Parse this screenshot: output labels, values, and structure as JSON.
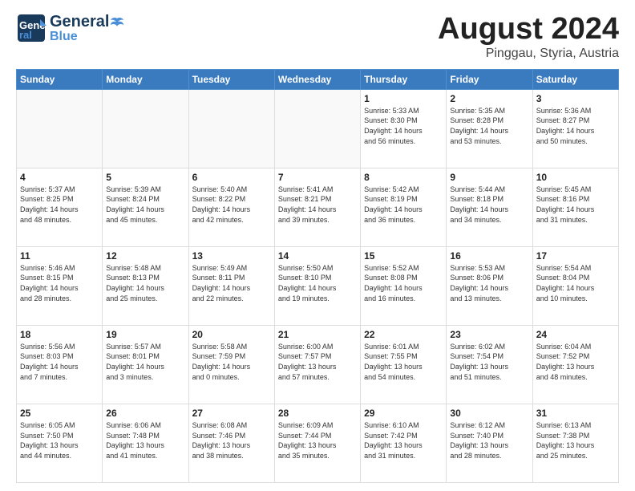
{
  "header": {
    "logo": {
      "line1": "General",
      "line2": "Blue",
      "tagline": ""
    },
    "title": "August 2024",
    "subtitle": "Pinggau, Styria, Austria"
  },
  "days_of_week": [
    "Sunday",
    "Monday",
    "Tuesday",
    "Wednesday",
    "Thursday",
    "Friday",
    "Saturday"
  ],
  "weeks": [
    [
      {
        "day": "",
        "info": ""
      },
      {
        "day": "",
        "info": ""
      },
      {
        "day": "",
        "info": ""
      },
      {
        "day": "",
        "info": ""
      },
      {
        "day": "1",
        "info": "Sunrise: 5:33 AM\nSunset: 8:30 PM\nDaylight: 14 hours\nand 56 minutes."
      },
      {
        "day": "2",
        "info": "Sunrise: 5:35 AM\nSunset: 8:28 PM\nDaylight: 14 hours\nand 53 minutes."
      },
      {
        "day": "3",
        "info": "Sunrise: 5:36 AM\nSunset: 8:27 PM\nDaylight: 14 hours\nand 50 minutes."
      }
    ],
    [
      {
        "day": "4",
        "info": "Sunrise: 5:37 AM\nSunset: 8:25 PM\nDaylight: 14 hours\nand 48 minutes."
      },
      {
        "day": "5",
        "info": "Sunrise: 5:39 AM\nSunset: 8:24 PM\nDaylight: 14 hours\nand 45 minutes."
      },
      {
        "day": "6",
        "info": "Sunrise: 5:40 AM\nSunset: 8:22 PM\nDaylight: 14 hours\nand 42 minutes."
      },
      {
        "day": "7",
        "info": "Sunrise: 5:41 AM\nSunset: 8:21 PM\nDaylight: 14 hours\nand 39 minutes."
      },
      {
        "day": "8",
        "info": "Sunrise: 5:42 AM\nSunset: 8:19 PM\nDaylight: 14 hours\nand 36 minutes."
      },
      {
        "day": "9",
        "info": "Sunrise: 5:44 AM\nSunset: 8:18 PM\nDaylight: 14 hours\nand 34 minutes."
      },
      {
        "day": "10",
        "info": "Sunrise: 5:45 AM\nSunset: 8:16 PM\nDaylight: 14 hours\nand 31 minutes."
      }
    ],
    [
      {
        "day": "11",
        "info": "Sunrise: 5:46 AM\nSunset: 8:15 PM\nDaylight: 14 hours\nand 28 minutes."
      },
      {
        "day": "12",
        "info": "Sunrise: 5:48 AM\nSunset: 8:13 PM\nDaylight: 14 hours\nand 25 minutes."
      },
      {
        "day": "13",
        "info": "Sunrise: 5:49 AM\nSunset: 8:11 PM\nDaylight: 14 hours\nand 22 minutes."
      },
      {
        "day": "14",
        "info": "Sunrise: 5:50 AM\nSunset: 8:10 PM\nDaylight: 14 hours\nand 19 minutes."
      },
      {
        "day": "15",
        "info": "Sunrise: 5:52 AM\nSunset: 8:08 PM\nDaylight: 14 hours\nand 16 minutes."
      },
      {
        "day": "16",
        "info": "Sunrise: 5:53 AM\nSunset: 8:06 PM\nDaylight: 14 hours\nand 13 minutes."
      },
      {
        "day": "17",
        "info": "Sunrise: 5:54 AM\nSunset: 8:04 PM\nDaylight: 14 hours\nand 10 minutes."
      }
    ],
    [
      {
        "day": "18",
        "info": "Sunrise: 5:56 AM\nSunset: 8:03 PM\nDaylight: 14 hours\nand 7 minutes."
      },
      {
        "day": "19",
        "info": "Sunrise: 5:57 AM\nSunset: 8:01 PM\nDaylight: 14 hours\nand 3 minutes."
      },
      {
        "day": "20",
        "info": "Sunrise: 5:58 AM\nSunset: 7:59 PM\nDaylight: 14 hours\nand 0 minutes."
      },
      {
        "day": "21",
        "info": "Sunrise: 6:00 AM\nSunset: 7:57 PM\nDaylight: 13 hours\nand 57 minutes."
      },
      {
        "day": "22",
        "info": "Sunrise: 6:01 AM\nSunset: 7:55 PM\nDaylight: 13 hours\nand 54 minutes."
      },
      {
        "day": "23",
        "info": "Sunrise: 6:02 AM\nSunset: 7:54 PM\nDaylight: 13 hours\nand 51 minutes."
      },
      {
        "day": "24",
        "info": "Sunrise: 6:04 AM\nSunset: 7:52 PM\nDaylight: 13 hours\nand 48 minutes."
      }
    ],
    [
      {
        "day": "25",
        "info": "Sunrise: 6:05 AM\nSunset: 7:50 PM\nDaylight: 13 hours\nand 44 minutes."
      },
      {
        "day": "26",
        "info": "Sunrise: 6:06 AM\nSunset: 7:48 PM\nDaylight: 13 hours\nand 41 minutes."
      },
      {
        "day": "27",
        "info": "Sunrise: 6:08 AM\nSunset: 7:46 PM\nDaylight: 13 hours\nand 38 minutes."
      },
      {
        "day": "28",
        "info": "Sunrise: 6:09 AM\nSunset: 7:44 PM\nDaylight: 13 hours\nand 35 minutes."
      },
      {
        "day": "29",
        "info": "Sunrise: 6:10 AM\nSunset: 7:42 PM\nDaylight: 13 hours\nand 31 minutes."
      },
      {
        "day": "30",
        "info": "Sunrise: 6:12 AM\nSunset: 7:40 PM\nDaylight: 13 hours\nand 28 minutes."
      },
      {
        "day": "31",
        "info": "Sunrise: 6:13 AM\nSunset: 7:38 PM\nDaylight: 13 hours\nand 25 minutes."
      }
    ]
  ]
}
